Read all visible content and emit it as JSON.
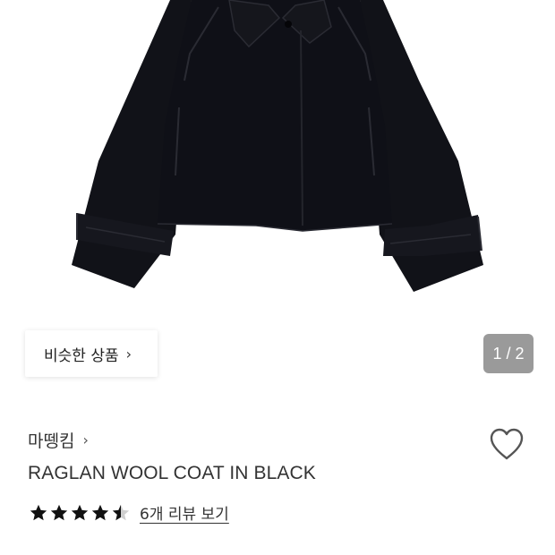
{
  "product_image": {
    "subject": "jacket-photo",
    "pager": {
      "current": 1,
      "total": 2,
      "label": "1 / 2"
    }
  },
  "similar_button": {
    "label": "비슷한 상품",
    "icon": "chevron-right-icon"
  },
  "product": {
    "brand": "마뗑킴",
    "name": "RAGLAN WOOL COAT IN BLACK",
    "rating": 4.5,
    "rating_max": 5,
    "review_link": "6개 리뷰 보기"
  },
  "colors": {
    "star": "#111111",
    "counter_bg": "#9a9a9a",
    "heart_stroke": "#555555",
    "coat": "#101118"
  }
}
